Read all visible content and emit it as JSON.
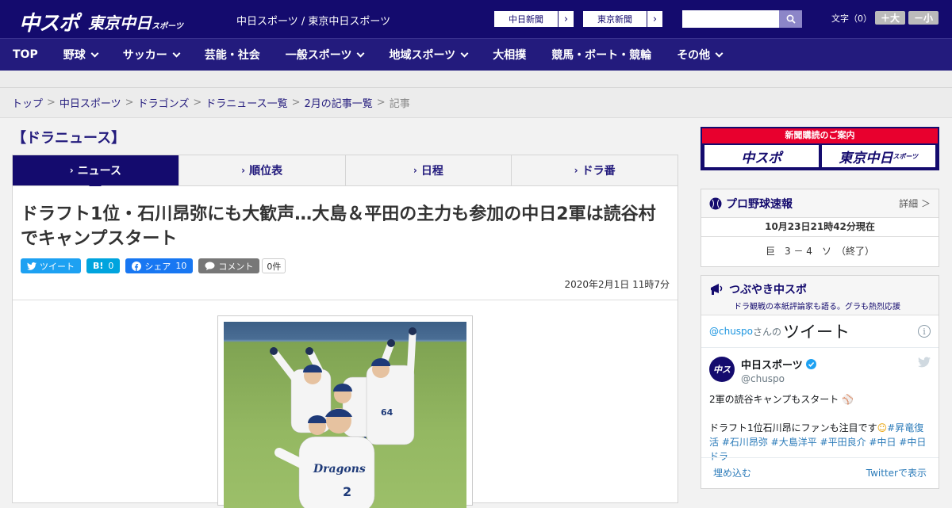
{
  "header": {
    "logo_main": "中スポ",
    "logo_sub": "東京中日",
    "logo_sub_small": "スポーツ",
    "site_name": "中日スポーツ / 東京中日スポーツ",
    "ext_links": [
      "中日新聞",
      "東京新聞"
    ],
    "search_placeholder": "",
    "font_size_label": "文字（0）",
    "font_larger": "＋大",
    "font_smaller": "－小"
  },
  "nav": [
    {
      "label": "TOP",
      "dropdown": false
    },
    {
      "label": "野球",
      "dropdown": true
    },
    {
      "label": "サッカー",
      "dropdown": true
    },
    {
      "label": "芸能・社会",
      "dropdown": false
    },
    {
      "label": "一般スポーツ",
      "dropdown": true
    },
    {
      "label": "地域スポーツ",
      "dropdown": true
    },
    {
      "label": "大相撲",
      "dropdown": false
    },
    {
      "label": "競馬・ボート・競輪",
      "dropdown": false
    },
    {
      "label": "その他",
      "dropdown": true
    }
  ],
  "breadcrumb": [
    "トップ",
    "中日スポーツ",
    "ドラゴンズ",
    "ドラニュース一覧",
    "2月の記事一覧",
    "記事"
  ],
  "section_title": "【ドラニュース】",
  "tabs": [
    "ニュース",
    "順位表",
    "日程",
    "ドラ番"
  ],
  "article": {
    "headline": "ドラフト1位・石川昂弥にも大歓声…大島＆平田の主力も参加の中日2軍は読谷村でキャンプスタート",
    "tweet_label": "ツイート",
    "hatena_label": "B!",
    "hatena_count": "0",
    "share_label": "シェア",
    "share_count": "10",
    "comment_label": "コメント",
    "comment_count": "0件",
    "date": "2020年2月1日 11時7分"
  },
  "sidebar": {
    "promo_title": "新聞購読のご案内",
    "promo_left": "中スポ",
    "promo_right": "東京中日",
    "promo_right_small": "スポーツ",
    "baseball_title": "プロ野球速報",
    "baseball_more": "詳細 ＞",
    "score_time": "10月23日21時42分現在",
    "score_line": "巨　3 － 4　ソ　（終了）",
    "tsubuyaki_title": "つぶやき中スポ",
    "tsubuyaki_sub": "ドラ観戦の本紙評論家も語る。グラも熱烈応援",
    "twitter": {
      "handle_prefix": "@chuspo",
      "handle_suffix": "さんの",
      "heading": "ツイート",
      "user_name": "中日スポーツ",
      "user_handle": "@chuspo",
      "line1": "2軍の読谷キャンプもスタート",
      "line2_text": "ドラフト1位石川昂にファンも注目です",
      "tags": "#昇竜復活 #石川昂弥 #大島洋平 #平田良介 #中日 #中日ドラ",
      "embed_label": "埋め込む",
      "view_label": "Twitterで表示"
    }
  },
  "colors": {
    "brand_navy": "#140b6e",
    "nav_bg": "#231b7d",
    "promo_red": "#e8002e",
    "twitter_blue": "#1da1f2",
    "facebook_blue": "#1877f2"
  }
}
